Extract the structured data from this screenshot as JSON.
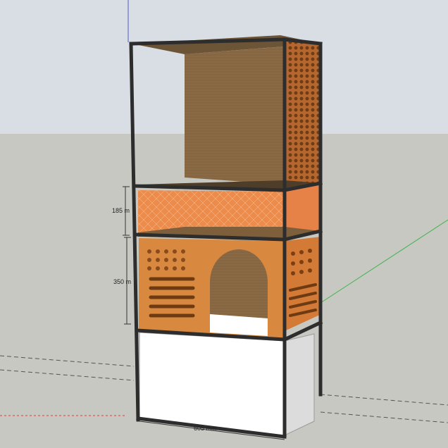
{
  "scene": {
    "colors": {
      "sky": "#d9dee5",
      "ground": "#c8c8c3",
      "frame": "#2d2d2d",
      "plywood": "#8b6a43",
      "acrylic_orange": "#ec8b4a",
      "white_box": "#ffffff"
    },
    "dimensions": {
      "height_upper": "185 m",
      "height_lower": "350 m",
      "width_bottom": "605 mm"
    }
  }
}
